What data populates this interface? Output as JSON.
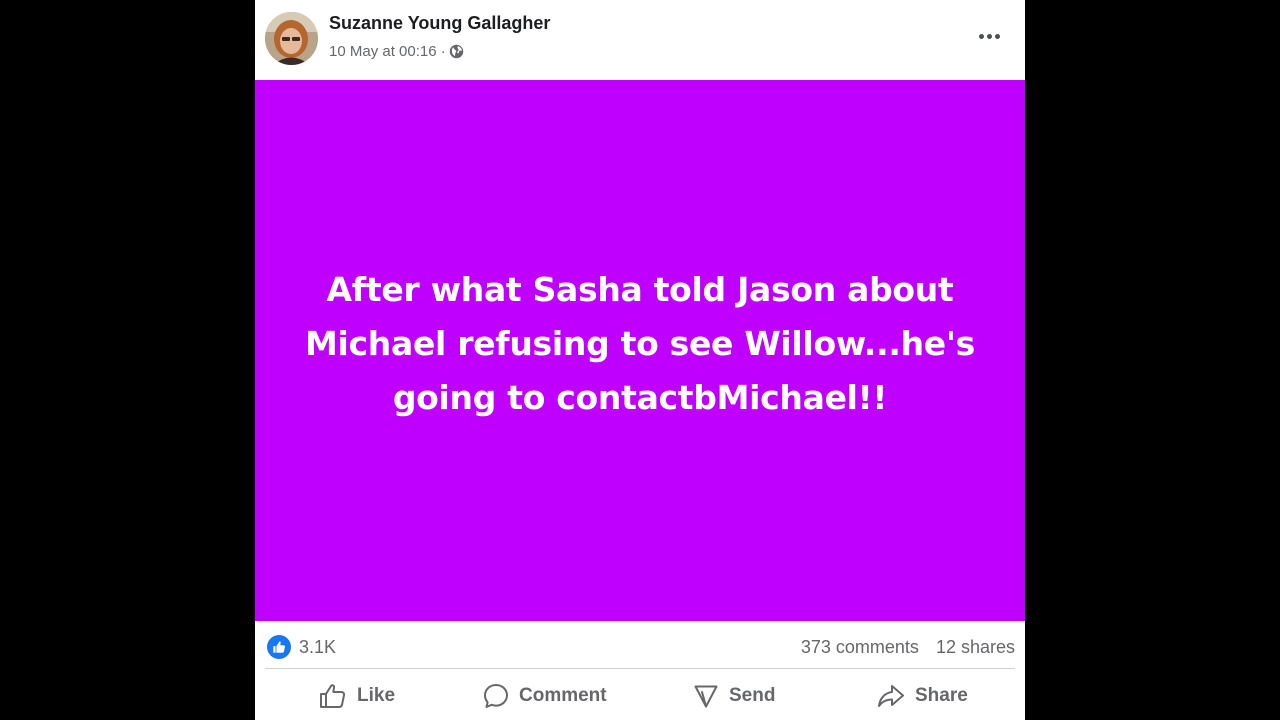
{
  "post": {
    "author": "Suzanne Young Gallagher",
    "timestamp": "10 May at 00:16",
    "separator": "·",
    "audience_icon": "globe-icon",
    "status_text": "After what Sasha told Jason about Michael refusing to see Willow...he's going to contactbMichael!!",
    "background_color": "#c000ff",
    "text_color": "#ffffff"
  },
  "stats": {
    "reaction_icon": "like-icon",
    "reaction_color": "#1877f2",
    "reaction_count": "3.1K",
    "comments": "373 comments",
    "shares": "12 shares"
  },
  "actions": {
    "like": "Like",
    "comment": "Comment",
    "send": "Send",
    "share": "Share"
  }
}
